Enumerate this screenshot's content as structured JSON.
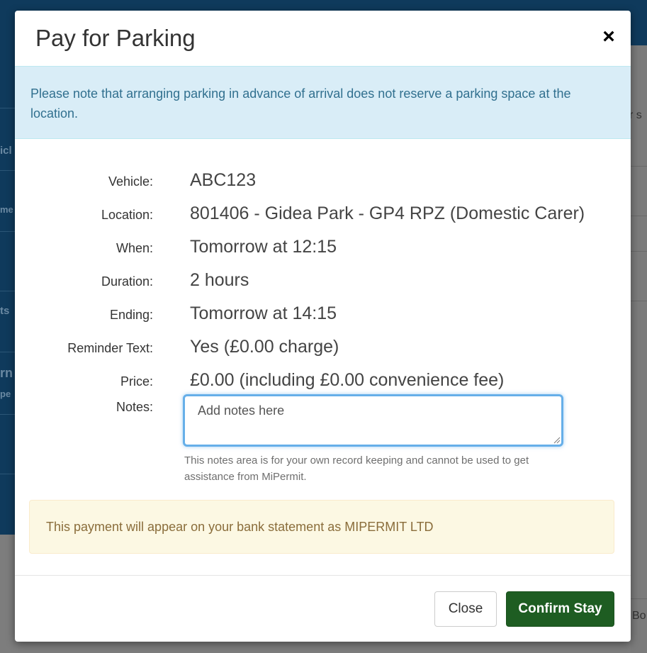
{
  "modal": {
    "title": "Pay for Parking",
    "close_symbol": "×",
    "info_notice": "Please note that arranging parking in advance of arrival does not reserve a parking space at the location.",
    "details": [
      {
        "label": "Vehicle:",
        "value": "ABC123"
      },
      {
        "label": "Location:",
        "value": "801406 - Gidea Park - GP4 RPZ (Domestic Carer)"
      },
      {
        "label": "When:",
        "value": "Tomorrow at 12:15"
      },
      {
        "label": "Duration:",
        "value": "2 hours"
      },
      {
        "label": "Ending:",
        "value": "Tomorrow at 14:15"
      },
      {
        "label": "Reminder Text:",
        "value": "Yes (£0.00 charge)"
      },
      {
        "label": "Price:",
        "value": "£0.00 (including £0.00 convenience fee)"
      }
    ],
    "notes": {
      "label": "Notes:",
      "placeholder": "Add notes here",
      "value": "",
      "help_text": "This notes area is for your own record keeping and cannot be used to get assistance from MiPermit."
    },
    "statement_notice": "This payment will appear on your bank statement as MIPERMIT LTD",
    "buttons": {
      "close": "Close",
      "confirm": "Confirm Stay"
    }
  },
  "background_fragments": {
    "left": [
      "icl",
      "me",
      "ts",
      "rn",
      "pe"
    ],
    "right": [
      "r s",
      "Bo"
    ]
  },
  "colors": {
    "info_bg": "#d9edf7",
    "info_text": "#31708f",
    "warning_bg": "#fcf8e3",
    "warning_text": "#8a6d3b",
    "confirm_button": "#1e5d22",
    "focus_border": "#66afe9",
    "page_header": "#0f3a5c"
  }
}
